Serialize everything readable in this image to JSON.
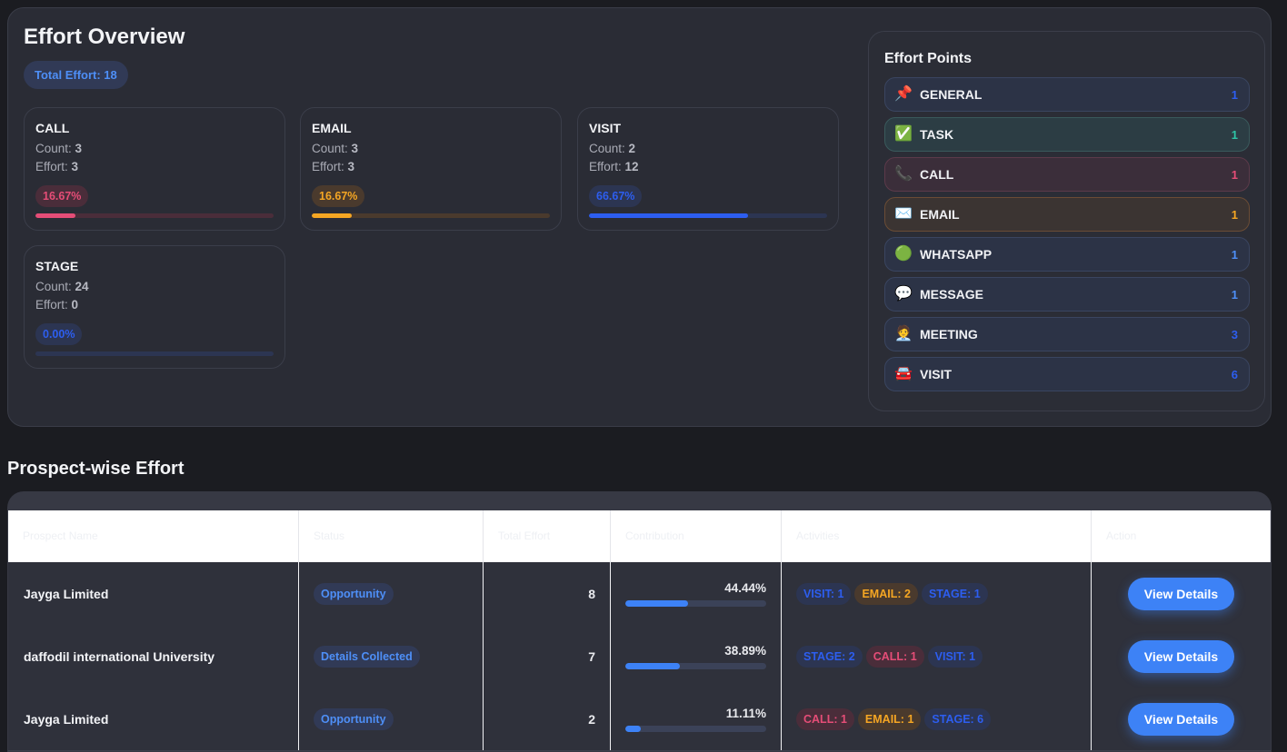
{
  "overview": {
    "title": "Effort Overview",
    "total_label": "Total Effort: 18",
    "count_label": "Count:",
    "effort_label": "Effort:",
    "cards": [
      {
        "name": "CALL",
        "count": "3",
        "effort": "3",
        "percent": "16.67%",
        "fill": 0.1667,
        "color": "#e54d77",
        "pill_bg": "#4a2d3a",
        "track_bg": "#4a2d3a"
      },
      {
        "name": "EMAIL",
        "count": "3",
        "effort": "3",
        "percent": "16.67%",
        "fill": 0.1667,
        "color": "#f5a623",
        "pill_bg": "#4a3a2d",
        "track_bg": "#4a3a2d"
      },
      {
        "name": "VISIT",
        "count": "2",
        "effort": "12",
        "percent": "66.67%",
        "fill": 0.6667,
        "color": "#2d5ef0",
        "pill_bg": "#2c3552",
        "track_bg": "#2c3552"
      },
      {
        "name": "STAGE",
        "count": "24",
        "effort": "0",
        "percent": "0.00%",
        "fill": 0,
        "color": "#2d5ef0",
        "pill_bg": "#2c3552",
        "track_bg": "#2c3552"
      }
    ]
  },
  "effort_points": {
    "title": "Effort Points",
    "items": [
      {
        "icon": "pushpin-icon",
        "glyph": "📌",
        "label": "GENERAL",
        "value": "1",
        "bg": "#2c3346",
        "border": "#3a4560",
        "color": "#2d5ef0"
      },
      {
        "icon": "check-mark-icon",
        "glyph": "✅",
        "label": "TASK",
        "value": "1",
        "bg": "#2c3d44",
        "border": "#3a5a5c",
        "color": "#2ec4a6"
      },
      {
        "icon": "telephone-icon",
        "glyph": "📞",
        "label": "CALL",
        "value": "1",
        "bg": "#3b2e3a",
        "border": "#5c3a4a",
        "color": "#e54d77"
      },
      {
        "icon": "envelope-icon",
        "glyph": "✉️",
        "label": "EMAIL",
        "value": "1",
        "bg": "#3b3432",
        "border": "#6b4c35",
        "color": "#f5a623"
      },
      {
        "icon": "green-circle-icon",
        "glyph": "🟢",
        "label": "WHATSAPP",
        "value": "1",
        "bg": "#2c3346",
        "border": "#3a4560",
        "color": "#4e8ff7"
      },
      {
        "icon": "speech-bubble-icon",
        "glyph": "💬",
        "label": "MESSAGE",
        "value": "1",
        "bg": "#2c3346",
        "border": "#3a4560",
        "color": "#4e8ff7"
      },
      {
        "icon": "person-in-suit-icon",
        "glyph": "🧑‍💼",
        "label": "MEETING",
        "value": "3",
        "bg": "#2c3346",
        "border": "#3a4560",
        "color": "#2d5ef0"
      },
      {
        "icon": "car-icon",
        "glyph": "🚘",
        "label": "VISIT",
        "value": "6",
        "bg": "#2c3346",
        "border": "#3a4560",
        "color": "#2d5ef0"
      }
    ]
  },
  "prospects": {
    "title": "Prospect-wise Effort",
    "columns": [
      "Prospect Name",
      "Status",
      "Total Effort",
      "Contribution",
      "Activities",
      "Action"
    ],
    "rows": [
      {
        "name": "Jayga Limited",
        "status": "Opportunity",
        "effort": "8",
        "percent": "44.44%",
        "fill": 0.4444,
        "activities": [
          {
            "text": "VISIT: 1",
            "color": "#2d5ef0",
            "bg": "#2c3552"
          },
          {
            "text": "EMAIL: 2",
            "color": "#f5a623",
            "bg": "#4a3a2d"
          },
          {
            "text": "STAGE: 1",
            "color": "#2d5ef0",
            "bg": "#2c3552"
          }
        ],
        "action": "View Details"
      },
      {
        "name": "daffodil international University",
        "status": "Details Collected",
        "effort": "7",
        "percent": "38.89%",
        "fill": 0.3889,
        "activities": [
          {
            "text": "STAGE: 2",
            "color": "#2d5ef0",
            "bg": "#2c3552"
          },
          {
            "text": "CALL: 1",
            "color": "#e54d77",
            "bg": "#4a2d3a"
          },
          {
            "text": "VISIT: 1",
            "color": "#2d5ef0",
            "bg": "#2c3552"
          }
        ],
        "action": "View Details"
      },
      {
        "name": "Jayga Limited",
        "status": "Opportunity",
        "effort": "2",
        "percent": "11.11%",
        "fill": 0.1111,
        "activities": [
          {
            "text": "CALL: 1",
            "color": "#e54d77",
            "bg": "#4a2d3a"
          },
          {
            "text": "EMAIL: 1",
            "color": "#f5a623",
            "bg": "#4a3a2d"
          },
          {
            "text": "STAGE: 6",
            "color": "#2d5ef0",
            "bg": "#2c3552"
          }
        ],
        "action": "View Details"
      }
    ]
  }
}
